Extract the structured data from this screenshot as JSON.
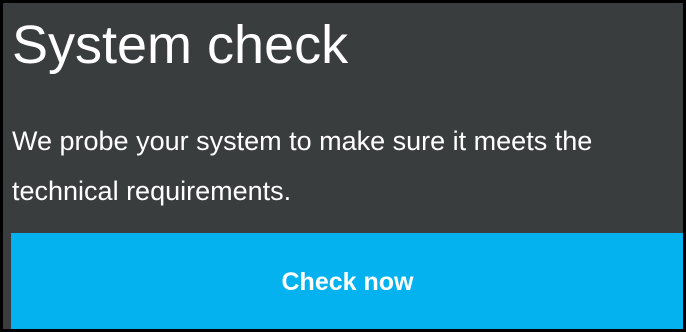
{
  "card": {
    "title": "System check",
    "description": "We probe your system to make sure it meets the technical requirements.",
    "button_label": "Check now"
  },
  "colors": {
    "background": "#3a3d3e",
    "accent": "#03b2ee",
    "text": "#ffffff",
    "border": "#000000"
  }
}
